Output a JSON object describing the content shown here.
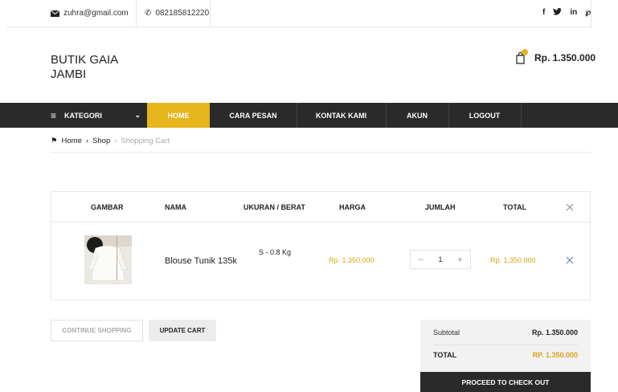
{
  "topbar": {
    "email": "zuhra@gmail.com",
    "phone": "082185812220",
    "socials": [
      "f",
      "y",
      "in",
      "p"
    ]
  },
  "brand": {
    "line1": "BUTIK GAIA",
    "line2": "JAMBI"
  },
  "mini_cart": {
    "total": "Rp. 1.350.000",
    "icon": "shopping-bag-icon"
  },
  "nav": {
    "category_label": "KATEGORI",
    "items": [
      "HOME",
      "CARA PESAN",
      "KONTAK KAMI",
      "AKUN",
      "LOGOUT"
    ],
    "active_index": 0
  },
  "breadcrumb": {
    "home": "Home",
    "shop": "Shop",
    "current": "Shopping Cart"
  },
  "cart": {
    "headers": [
      "GAMBAR",
      "NAMA",
      "UKURAN / BERAT",
      "HARGA",
      "JUMLAH",
      "TOTAL"
    ],
    "items": [
      {
        "name": "Blouse Tunik 135k",
        "size_weight": "S - 0.8 Kg",
        "price": "Rp. 1.350.000",
        "quantity": "1",
        "total": "Rp. 1.350.000"
      }
    ]
  },
  "actions": {
    "continue_label": "CONTINUE SHOPPING",
    "update_label": "UPDATE CART"
  },
  "totals": {
    "subtotal_label": "Subtotal",
    "subtotal_value": "Rp. 1.350.000",
    "total_label": "TOTAL",
    "total_value": "RP. 1.350.000",
    "checkout_label": "PROCEED TO CHECK OUT"
  },
  "colors": {
    "accent": "#e5b51c",
    "nav_bg": "#2a2a2a",
    "price": "#d6a419",
    "remove": "#5a7bd6"
  }
}
